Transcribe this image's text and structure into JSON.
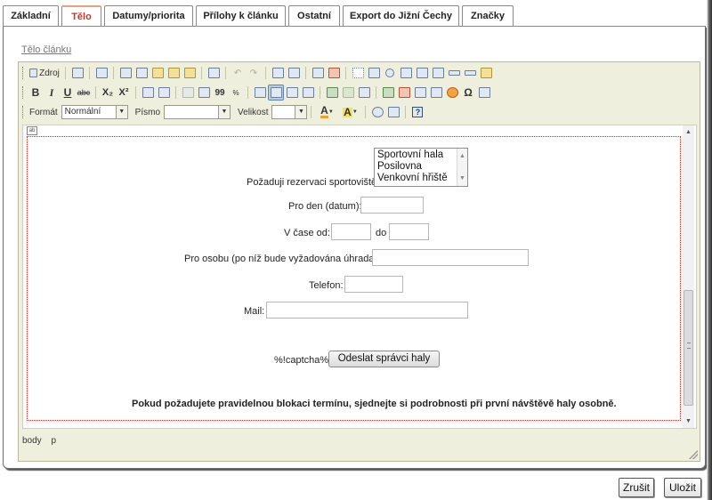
{
  "tabs": [
    {
      "label": "Základní",
      "active": false
    },
    {
      "label": "Tělo",
      "active": true
    },
    {
      "label": "Datumy/priorita",
      "active": false
    },
    {
      "label": "Přílohy k článku",
      "active": false
    },
    {
      "label": "Ostatní",
      "active": false
    },
    {
      "label": "Export do Jižní Čechy",
      "active": false
    },
    {
      "label": "Značky",
      "active": false
    }
  ],
  "section_link": "Tělo článku",
  "toolbar": {
    "source_label": "Zdroj",
    "bold": "B",
    "italic": "I",
    "underline": "U",
    "strike": "abc",
    "subscript": "X₂",
    "superscript": "X²",
    "quote": "99",
    "omega": "Ω",
    "format_label": "Formát",
    "format_value": "Normální",
    "font_label": "Písmo",
    "font_value": "",
    "size_label": "Velikost",
    "size_value": "",
    "help": "?"
  },
  "form": {
    "reservation_label": "Požaduji rezervaci sportoviště:",
    "venues": [
      "Sportovní hala",
      "Posilovna",
      "Venkovní hřiště"
    ],
    "day_label": "Pro den (datum):",
    "time_from_label": "V čase od:",
    "time_to_label": "do",
    "person_label": "Pro osobu (po níž bude vyžadována úhrada):",
    "phone_label": "Telefon:",
    "mail_label": "Mail:",
    "captcha_label": "%!captcha%!",
    "submit_label": "Odeslat správci haly",
    "note": "Pokud požadujete pravidelnou blokaci termínu, sjednejte si podrobnosti při první návštěvě haly osobně."
  },
  "statusbar": [
    "body",
    "p"
  ],
  "footer": {
    "cancel_label": "Zrušit",
    "save_label": "Uložit"
  }
}
